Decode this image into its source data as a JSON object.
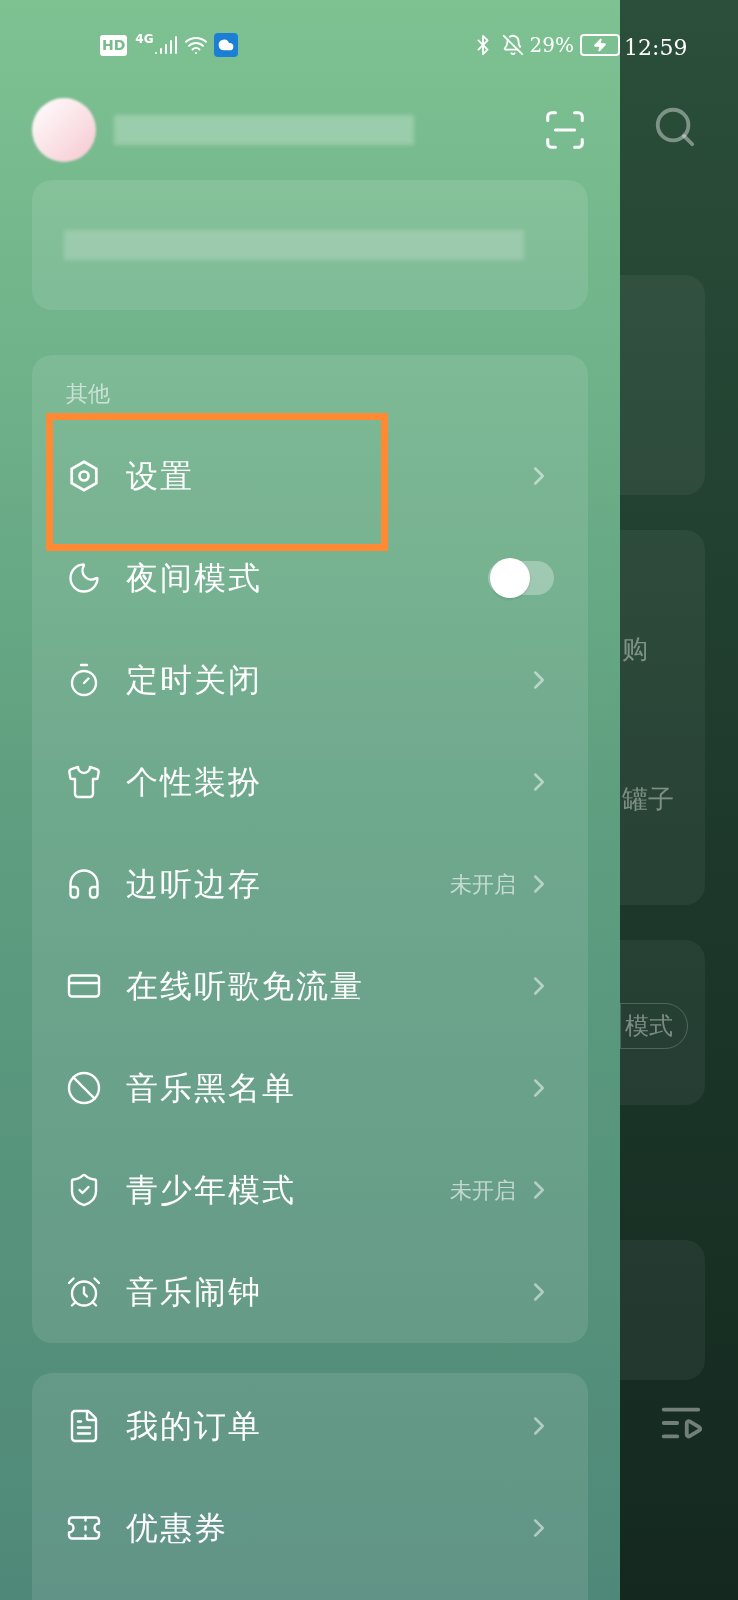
{
  "status_bar": {
    "hd": "HD",
    "network": "4G",
    "battery": "29%",
    "time": "12:59"
  },
  "menu_section": {
    "title": "其他",
    "items": [
      {
        "kind": "link",
        "label": "设置",
        "highlighted": true
      },
      {
        "kind": "toggle",
        "label": "夜间模式",
        "on": false,
        "highlighted": false
      },
      {
        "kind": "link",
        "label": "定时关闭",
        "highlighted": false
      },
      {
        "kind": "link",
        "label": "个性装扮",
        "highlighted": false
      },
      {
        "kind": "link",
        "label": "边听边存",
        "status": "未开启",
        "highlighted": false
      },
      {
        "kind": "link",
        "label": "在线听歌免流量",
        "highlighted": false
      },
      {
        "kind": "link",
        "label": "音乐黑名单",
        "highlighted": false
      },
      {
        "kind": "link",
        "label": "青少年模式",
        "status": "未开启",
        "highlighted": false
      },
      {
        "kind": "link",
        "label": "音乐闹钟",
        "highlighted": false
      }
    ]
  },
  "orders_section": {
    "items": [
      {
        "kind": "link",
        "label": "我的订单"
      },
      {
        "kind": "link",
        "label": "优惠券"
      }
    ]
  },
  "background_page": {
    "texts": [
      "购",
      "罐子",
      "模式"
    ]
  }
}
